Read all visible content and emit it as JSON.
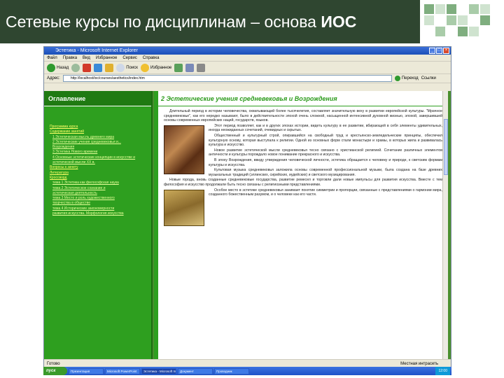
{
  "slide": {
    "title_main": "Сетевые курсы по дисциплинам – основа",
    "title_bold": "ИОС"
  },
  "browser": {
    "window_title": "Эстетика - Microsoft Internet Explorer",
    "menu": [
      "Файл",
      "Правка",
      "Вид",
      "Избранное",
      "Сервис",
      "Справка"
    ],
    "toolbar": {
      "back": "Назад",
      "search": "Поиск",
      "favorites": "Избранное"
    },
    "address_label": "Адрес:",
    "address_value": "http://localhost/ioc/courses/aesthetics/index.htm",
    "go_label": "Переход",
    "links_label": "Ссылки"
  },
  "left_pane": {
    "header": "Оглавление",
    "toc": [
      {
        "text": "Программа курса",
        "level": 1
      },
      {
        "text": "Содержание занятий",
        "level": 1
      },
      {
        "text": "1 Эстетическая мысль древнего мира",
        "level": 2
      },
      {
        "text": "2 Эстетические учения средневековья и...",
        "level": 2
      },
      {
        "text": "Возрождения",
        "level": 2
      },
      {
        "text": "3 Эстетика Нового времени",
        "level": 2
      },
      {
        "text": "4 Основные эстетические концепции в искусстве и",
        "level": 2
      },
      {
        "text": "эстетической мысли XX в.",
        "level": 2
      },
      {
        "text": "Вопросы к зачету",
        "level": 1
      },
      {
        "text": "Литература",
        "level": 1
      },
      {
        "text": "Кроссворд",
        "level": 1
      },
      {
        "text": "тема 1 Эстетика как философская наука",
        "level": 2
      },
      {
        "text": "тема 2 Эстетическое сознание и",
        "level": 2
      },
      {
        "text": "эстетическая деятельность",
        "level": 2
      },
      {
        "text": "тема 3 Место и роль художественного",
        "level": 2
      },
      {
        "text": "творчества в обществе",
        "level": 2
      },
      {
        "text": "тема 4 Исторические закономерности",
        "level": 2
      },
      {
        "text": "развития искусства. Морфология искусства",
        "level": 2
      }
    ]
  },
  "right_pane": {
    "header": "2 Эстетические учения средневековья и Возрождения",
    "paragraphs": [
      "Длительный период в истории человечества, охватывающий более тысячелетия, составляет значительную веху в развитии европейской культуры. \"Мрачное средневековье\", как его нередко называют, было в действительности эпохой очень сложной, насыщенной интенсивной духовной жизнью, эпохой, завершившей основы современных европейских наций, государств, языков.",
      "Этот период позволяет, как и в других эпохах истории, видеть культуру в ее развитии, вбирающей в себя элементы удивительных, иногда неожиданных сочетаний, очевидных и скрытых.",
      "Общественный и культурный строй, опиравшийся на свободный труд и крестьянско-земледельческие принципы, обеспечил культурную основу, которая выступала к религии. Одной из основных форм стали монастыри и храмы, в которых жила и развивалась культура и искусство.",
      "Новое развитие эстетической мысли средневековья тесно связано с христианской религией. Сочетание различных элементов античности и культуры порождало новое понимание прекрасного и искусства.",
      "В эпоху Возрождения, ввиду утверждения человеческой личности, эстетика обращается к человеку и природе, к светским формам культуры и искусства.",
      "Культовая музыка средневековья заложила основы современной профессиональной музыки, была создана на базе древних музыкальных традиций (эллинских, сирийских, иудейских) и светского музицирования.",
      "Новые города, вновь созданные средневековые государства, развитие ремесел и торговли дали новые импульсы для развития искусства. Вместе с тем философия и искусство продолжали быть тесно связаны с религиозными представлениями.",
      "Особое место в эстетике средневековья занимает понятие симметрии и пропорции, связанные с представлениями о гармонии мира, созданного божественным разумом, и о человеке как его части."
    ]
  },
  "status": {
    "left": "Готово",
    "zone": "Местная интрасеть"
  },
  "taskbar": {
    "start": "пуск",
    "tasks": [
      "Презентация",
      "Microsoft PowerPoint",
      "Эстетика - Microsoft Internet Explorer",
      "Документ",
      "Проводник"
    ],
    "tray": "12:00"
  },
  "colors": {
    "title_bg": "#2f4630",
    "left_pane_bg": "#2e9f1f",
    "header_green": "#2a9a1a",
    "toc_link": "#ffff66"
  }
}
